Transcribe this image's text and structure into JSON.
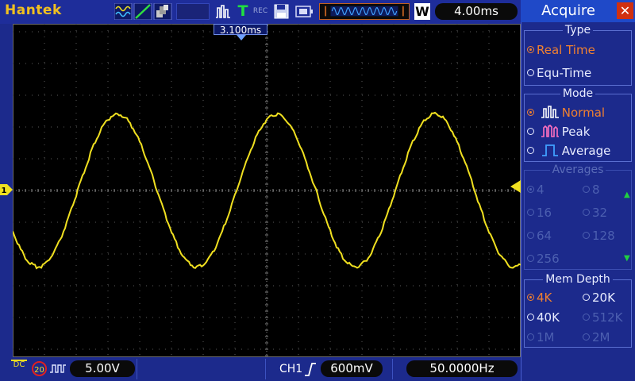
{
  "brand": "Hantek",
  "toolbar": {
    "timebase": "4.00ms",
    "window_label": "W",
    "record_label": "REC"
  },
  "screen": {
    "trigger_position": "3.100ms",
    "ch1_marker": "1",
    "trace_color": "#f0e020",
    "waveform": {
      "type": "sine",
      "frequency_hz": 50.0,
      "amplitude_divisions": 2.4
    }
  },
  "bottom": {
    "coupling": "DC",
    "bandwidth_limit": "20",
    "volts_per_div": "5.00V",
    "trigger_source": "CH1",
    "trigger_level": "600mV",
    "frequency": "50.0000Hz"
  },
  "panel": {
    "title": "Acquire",
    "close": "✕",
    "type": {
      "title": "Type",
      "options": [
        {
          "label": "Real Time",
          "selected": true
        },
        {
          "label": "Equ-Time",
          "selected": false
        }
      ]
    },
    "mode": {
      "title": "Mode",
      "options": [
        {
          "label": "Normal",
          "selected": true,
          "icon": "normal-acq-icon"
        },
        {
          "label": "Peak",
          "selected": false,
          "icon": "peak-acq-icon"
        },
        {
          "label": "Average",
          "selected": false,
          "icon": "average-acq-icon"
        }
      ]
    },
    "averages": {
      "title": "Averages",
      "options": [
        "4",
        "8",
        "16",
        "32",
        "64",
        "128",
        "256"
      ],
      "selected": "4"
    },
    "mem_depth": {
      "title": "Mem Depth",
      "options": [
        "4K",
        "20K",
        "40K",
        "512K",
        "1M",
        "2M"
      ],
      "selected": "4K",
      "disabled": [
        "512K",
        "1M",
        "2M"
      ]
    }
  },
  "colors": {
    "background": "#1c2a8c",
    "accent_orange": "#f08030",
    "brand_yellow": "#f0c020",
    "close_red": "#d03010"
  }
}
